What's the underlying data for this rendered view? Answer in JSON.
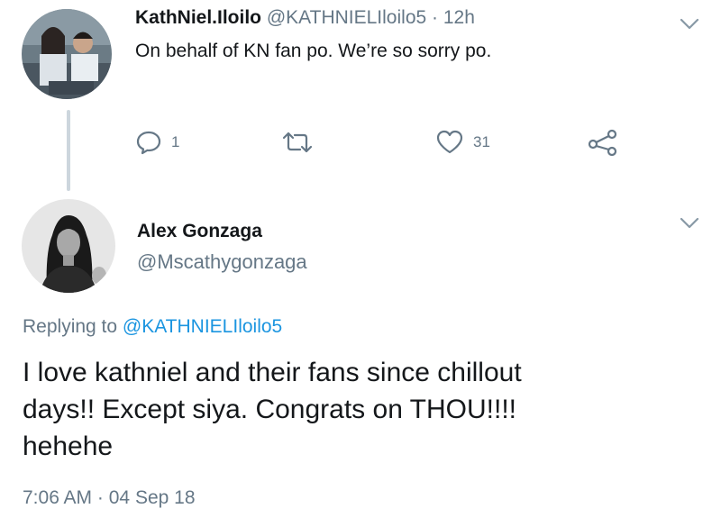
{
  "tweet1": {
    "display_name": "KathNiel.Iloilo",
    "handle": "@KATHNIELIloilo5",
    "separator": "·",
    "time": "12h",
    "text": "On behalf of KN fan po. We’re so sorry po.",
    "actions": {
      "reply_count": "1",
      "retweet_count": "",
      "like_count": "31"
    }
  },
  "tweet2": {
    "display_name": "Alex Gonzaga",
    "handle": "@Mscathygonzaga",
    "replying_prefix": "Replying to",
    "replying_to": "@KATHNIELIloilo5",
    "text_lines": [
      "I love kathniel and their fans since chillout",
      "days!! Except siya. Congrats on THOU!!!!",
      "hehehe"
    ],
    "time": "7:06 AM",
    "separator": "·",
    "date": "04 Sep 18"
  },
  "colors": {
    "text_primary": "#14171a",
    "text_secondary": "#657786",
    "link": "#1b95e0",
    "thread_line": "#cdd6dd"
  },
  "icons": [
    "chevron-down-icon",
    "reply-icon",
    "retweet-icon",
    "like-icon",
    "share-icon"
  ]
}
